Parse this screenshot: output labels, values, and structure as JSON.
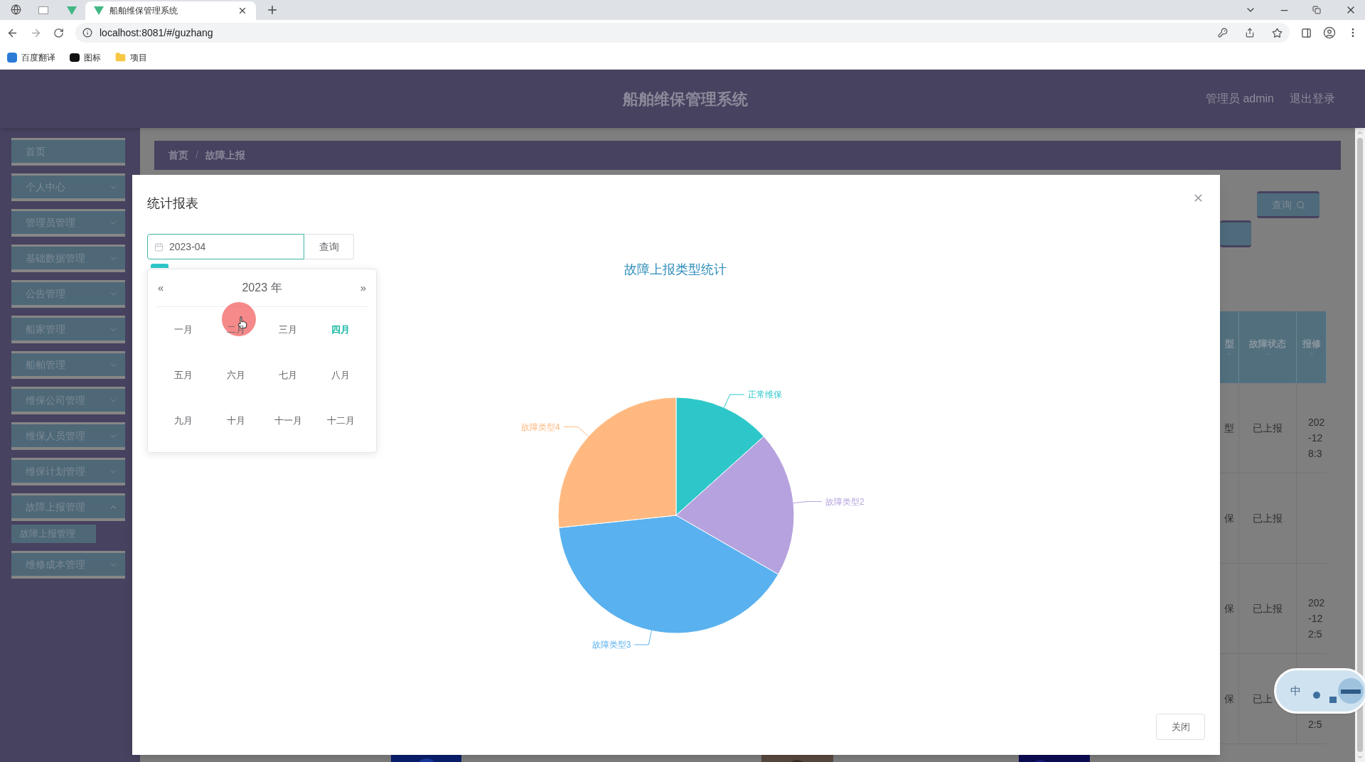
{
  "browser": {
    "tab_title": "船舶维保管理系统",
    "url": "localhost:8081/#/guzhang",
    "bookmarks": [
      {
        "label": "百度翻译",
        "kind": "translate"
      },
      {
        "label": "图标",
        "kind": "app"
      },
      {
        "label": "项目",
        "kind": "folder"
      }
    ]
  },
  "header": {
    "title": "船舶维保管理系统",
    "user": "管理员 admin",
    "logout": "退出登录"
  },
  "sidebar": {
    "items": [
      {
        "label": "首页",
        "kind": "link"
      },
      {
        "label": "个人中心",
        "kind": "submenu",
        "expanded": false
      },
      {
        "label": "管理员管理",
        "kind": "submenu",
        "expanded": false
      },
      {
        "label": "基础数据管理",
        "kind": "submenu",
        "expanded": false
      },
      {
        "label": "公告管理",
        "kind": "submenu",
        "expanded": false
      },
      {
        "label": "船家管理",
        "kind": "submenu",
        "expanded": false
      },
      {
        "label": "船舶管理",
        "kind": "submenu",
        "expanded": false
      },
      {
        "label": "维保公司管理",
        "kind": "submenu",
        "expanded": false
      },
      {
        "label": "维保人员管理",
        "kind": "submenu",
        "expanded": false
      },
      {
        "label": "维保计划管理",
        "kind": "submenu",
        "expanded": false
      },
      {
        "label": "故障上报管理",
        "kind": "submenu",
        "expanded": true,
        "children": [
          {
            "label": "故障上报管理"
          }
        ]
      },
      {
        "label": "维修成本管理",
        "kind": "submenu",
        "expanded": false
      }
    ]
  },
  "breadcrumb": {
    "items": [
      "首页",
      "故障上报"
    ],
    "separator": "/"
  },
  "background": {
    "search_button": "查询",
    "table": {
      "columns": [
        "型",
        "故障状态",
        "报修"
      ],
      "rows": [
        {
          "column_1": "型",
          "status": "已上报",
          "column_3": [
            "202",
            "-12",
            "8:3"
          ]
        },
        {
          "column_1": "保",
          "status": "已上报"
        },
        {
          "column_1": "保",
          "status": "已上报",
          "column_3": [
            "202",
            "-12",
            "2:5"
          ]
        },
        {
          "column_1": "保",
          "status": "已上",
          "column_3": [
            "2:5"
          ]
        }
      ]
    }
  },
  "ime_widget": {
    "mode": "中"
  },
  "dialog": {
    "title": "统计报表",
    "month_field": {
      "value": "2023-04"
    },
    "query_button": "查询",
    "close_button": "关闭",
    "picker": {
      "prev": "«",
      "year": "2023 年",
      "next": "»",
      "months": [
        {
          "label": "一月",
          "selected": false
        },
        {
          "label": "二月",
          "selected": false
        },
        {
          "label": "三月",
          "selected": false
        },
        {
          "label": "四月",
          "selected": true
        },
        {
          "label": "五月",
          "selected": false
        },
        {
          "label": "六月",
          "selected": false
        },
        {
          "label": "七月",
          "selected": false
        },
        {
          "label": "八月",
          "selected": false
        },
        {
          "label": "九月",
          "selected": false
        },
        {
          "label": "十月",
          "selected": false
        },
        {
          "label": "十一月",
          "selected": false
        },
        {
          "label": "十二月",
          "selected": false
        }
      ]
    },
    "legend": [
      {
        "color": "#2ec7c9"
      }
    ],
    "chart_data": {
      "type": "pie",
      "title": "故障上报类型统计",
      "categories": [
        "正常维保",
        "故障类型2",
        "故障类型3",
        "故障类型4"
      ],
      "values": [
        2,
        3,
        6,
        4
      ],
      "colors": [
        "#2ec7c9",
        "#b6a2de",
        "#5ab1ef",
        "#ffb980"
      ]
    }
  }
}
